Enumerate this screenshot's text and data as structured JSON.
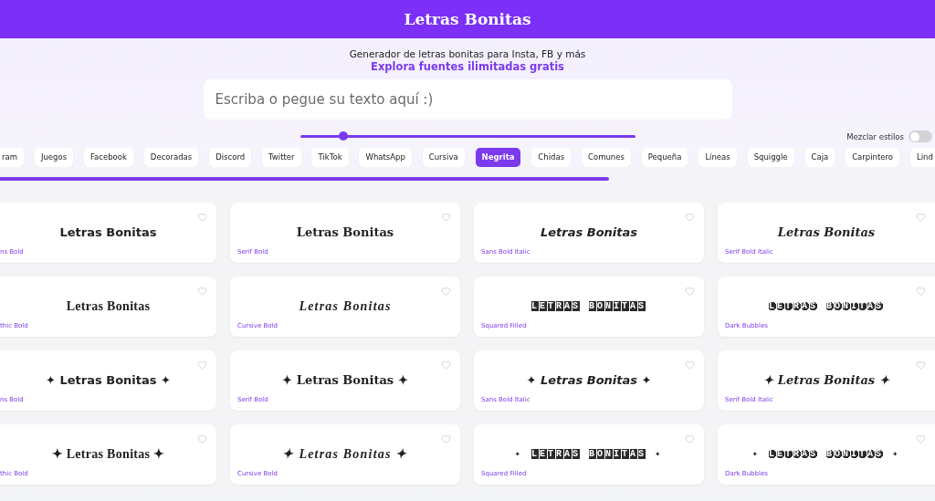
{
  "header": {
    "title": "Letras Bonitas"
  },
  "intro": {
    "subtitle": "Generador de letras bonitas para Insta, FB y más",
    "link": "Explora fuentes ilimitadas gratis"
  },
  "input": {
    "placeholder": "Escriba o pegue su texto aquí :)"
  },
  "size_slider": {
    "level": 0.13
  },
  "mix_toggle": {
    "label": "Mezclar estilos",
    "on": false
  },
  "tabs": [
    {
      "label": "ram",
      "selected": false
    },
    {
      "label": "Juegos",
      "selected": false
    },
    {
      "label": "Facebook",
      "selected": false
    },
    {
      "label": "Decoradas",
      "selected": false
    },
    {
      "label": "Discord",
      "selected": false
    },
    {
      "label": "Twitter",
      "selected": false
    },
    {
      "label": "TikTok",
      "selected": false
    },
    {
      "label": "WhatsApp",
      "selected": false
    },
    {
      "label": "Cursiva",
      "selected": false
    },
    {
      "label": "Negrita",
      "selected": true
    },
    {
      "label": "Chidas",
      "selected": false
    },
    {
      "label": "Comunes",
      "selected": false
    },
    {
      "label": "Pequeña",
      "selected": false
    },
    {
      "label": "Líneas",
      "selected": false
    },
    {
      "label": "Squiggle",
      "selected": false
    },
    {
      "label": "Caja",
      "selected": false
    },
    {
      "label": "Carpintero",
      "selected": false
    },
    {
      "label": "Lind",
      "selected": false
    }
  ],
  "cards": [
    {
      "text": "Letras Bonitas",
      "label": "ns Bold",
      "kind": "sans-bold"
    },
    {
      "text": "Letras Bonitas",
      "label": "Serif Bold",
      "kind": "serif-bold"
    },
    {
      "text": "Letras Bonitas",
      "label": "Sans Bold Italic",
      "kind": "sans-bold-italic"
    },
    {
      "text": "Letras Bonitas",
      "label": "Serif Bold Italic",
      "kind": "serif-bold-italic"
    },
    {
      "text": "Letras Bonitas",
      "label": "thic Bold",
      "kind": "gothic-bold"
    },
    {
      "text": "Letras Bonitas",
      "label": "Cursive Bold",
      "kind": "cursive-bold"
    },
    {
      "text": "LETRAS BONITAS",
      "label": "Squared Filled",
      "kind": "squared-filled"
    },
    {
      "text": "LETRAS BONITAS",
      "label": "Dark Bubbles",
      "kind": "dark-bubbles"
    },
    {
      "text": "✦ Letras Bonitas ✦",
      "label": "ns Bold",
      "kind": "sans-bold"
    },
    {
      "text": "✦ Letras Bonitas ✦",
      "label": "Serif Bold",
      "kind": "serif-bold"
    },
    {
      "text": "✦ Letras Bonitas ✦",
      "label": "Sans Bold Italic",
      "kind": "sans-bold-italic"
    },
    {
      "text": "✦ Letras Bonitas ✦",
      "label": "Serif Bold Italic",
      "kind": "serif-bold-italic"
    },
    {
      "text": "✦ Letras Bonitas ✦",
      "label": "thic Bold",
      "kind": "gothic-bold"
    },
    {
      "text": "✦ Letras Bonitas ✦",
      "label": "Cursive Bold",
      "kind": "cursive-bold"
    },
    {
      "text": "✦ LETRAS BONITAS ✦",
      "label": "Squared Filled",
      "kind": "squared-filled"
    },
    {
      "text": "✦ LETRAS BONITAS ✦",
      "label": "Dark Bubbles",
      "kind": "dark-bubbles"
    }
  ]
}
